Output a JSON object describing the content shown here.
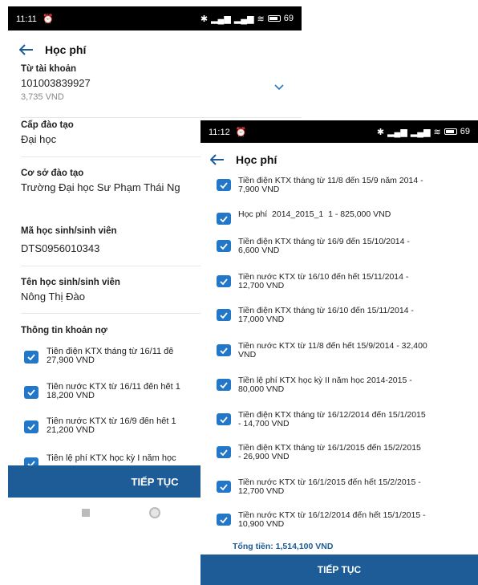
{
  "screenA": {
    "status": {
      "time": "11:11",
      "alarm_icon": "alarm-icon",
      "battery": "69"
    },
    "title": "Học phí",
    "account": {
      "label": "Từ tài khoản",
      "number": "101003839927",
      "balance": "3,735 VND"
    },
    "level": {
      "label": "Cấp đào tạo",
      "value": "Đại học"
    },
    "campus": {
      "label": "Cơ sở đào tạo",
      "value": "Trường Đại học Sư Phạm Thái Ng"
    },
    "student_id": {
      "label": "Mã học sinh/sinh viên",
      "value": "DTS0956010343"
    },
    "student_name": {
      "label": "Tên học sinh/sinh viên",
      "value": "Nông Thị Đào"
    },
    "debt_section": "Thông tin khoản nợ",
    "debts": [
      "Tiền điện KTX tháng từ 16/11 đế\n27,900 VND",
      "Tiền nước KTX từ 16/11 đến hết 1\n18,200 VND",
      "Tiền nước KTX từ 16/9 đến hết 1\n21,200 VND",
      "Tiền lệ phí KTX học kỳ I năm học"
    ],
    "button": "TIẾP TỤC"
  },
  "screenB": {
    "status": {
      "time": "11:12",
      "alarm_icon": "alarm-icon",
      "battery": "69"
    },
    "title": "Học phí",
    "debts": [
      "Tiền điện KTX tháng từ 11/8 đến 15/9 năm 2014 -\n7,900 VND",
      "Học phí  2014_2015_1  1 - 825,000 VND",
      "Tiền điện KTX tháng từ 16/9 đến 15/10/2014 -\n6,600 VND",
      "Tiền nước KTX từ 16/10 đến hết 15/11/2014 -\n12,700 VND",
      "Tiền điện KTX tháng từ 16/10 đến 15/11/2014 -\n17,000 VND",
      "Tiền nước KTX từ 11/8 đến hết 15/9/2014 - 32,400\nVND",
      "Tiền lệ phí KTX học kỳ II năm học 2014-2015 -\n80,000 VND",
      "Tiền điện KTX tháng từ 16/12/2014 đến 15/1/2015\n- 14,700 VND",
      "Tiền điện KTX tháng từ 16/1/2015 đến 15/2/2015\n- 26,900 VND",
      "Tiền nước KTX từ 16/1/2015 đến hết 15/2/2015 -\n12,700 VND",
      "Tiền nước KTX từ 16/12/2014 đến hết 15/1/2015 -\n10,900 VND"
    ],
    "total": "Tổng tiền: 1,514,100 VND",
    "button": "TIẾP TỤC"
  },
  "colors": {
    "primary": "#1d5c96",
    "checkbox": "#2377c8"
  }
}
